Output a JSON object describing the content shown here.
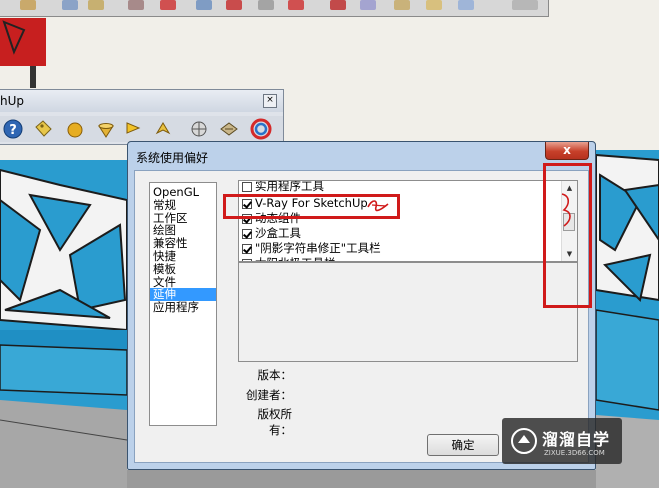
{
  "toolbar_window": {
    "title": "hUp"
  },
  "dialog": {
    "title": "系统使用偏好",
    "close_symbol": "x",
    "categories": [
      {
        "label": "OpenGL",
        "selected": false
      },
      {
        "label": "常规",
        "selected": false
      },
      {
        "label": "工作区",
        "selected": false
      },
      {
        "label": "绘图",
        "selected": false
      },
      {
        "label": "兼容性",
        "selected": false
      },
      {
        "label": "快捷",
        "selected": false
      },
      {
        "label": "模板",
        "selected": false
      },
      {
        "label": "文件",
        "selected": false
      },
      {
        "label": "延伸",
        "selected": true
      },
      {
        "label": "应用程序",
        "selected": false
      }
    ],
    "extensions": [
      {
        "label": "实用程序工具",
        "checked": false
      },
      {
        "label": "V-Ray For SketchUp",
        "checked": true
      },
      {
        "label": "动态组件",
        "checked": true
      },
      {
        "label": "沙盒工具",
        "checked": true
      },
      {
        "label": "\"阴影字符串修正\"工具栏",
        "checked": true
      },
      {
        "label": "太阳北极工具栏",
        "checked": true
      }
    ],
    "info": {
      "version_label": "版本：",
      "creator_label": "创建者：",
      "copyright_label": "版权所有："
    },
    "ok_label": "确定"
  },
  "watermark": {
    "title": "溜溜自学",
    "url": "ZIXUE.3D66.COM"
  },
  "colors": {
    "annotation_red": "#d01a1a",
    "selection_blue": "#3399ff",
    "dialog_frame": "#bcd1ea"
  }
}
